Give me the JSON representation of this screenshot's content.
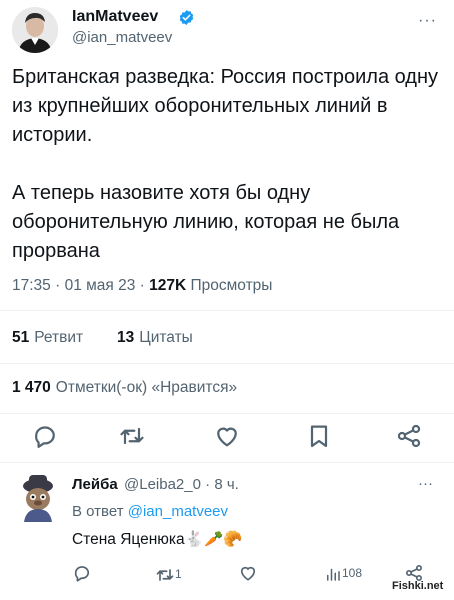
{
  "tweet": {
    "author_name": "IanMatveev",
    "author_handle": "@ian_matveev",
    "more_label": "···",
    "text": "Британская разведка: Россия построила одну из крупнейших оборонительных линий в истории.\n\nА теперь назовите хотя бы одну оборонительную линию, которая не была прорвана",
    "time": "17:35",
    "date": "01 мая 23",
    "views_count": "127K",
    "views_label": "Просмотры",
    "retweets_count": "51",
    "retweets_label": "Ретвит",
    "quotes_count": "13",
    "quotes_label": "Цитаты",
    "likes_count": "1 470",
    "likes_label": "Отметки(-ок) «Нравится»",
    "actions": {
      "reply_icon": "comment-icon",
      "retweet_icon": "retweet-icon",
      "like_icon": "heart-icon",
      "bookmark_icon": "bookmark-icon",
      "share_icon": "share-icon"
    }
  },
  "reply": {
    "author_name": "Лейба",
    "author_handle": "@Leiba2_0",
    "age": "8 ч.",
    "more_label": "···",
    "in_reply_label": "В ответ",
    "in_reply_mention": "@ian_matveev",
    "text": "Стена Яценюка",
    "emoji": "🐇🥕🥐",
    "retweet_count": "1",
    "views_count": "108"
  },
  "watermark": "Fishki.net",
  "colors": {
    "text": "#0f1419",
    "secondary": "#536471",
    "accent": "#1d9bf0",
    "divider": "#eff3f4"
  }
}
